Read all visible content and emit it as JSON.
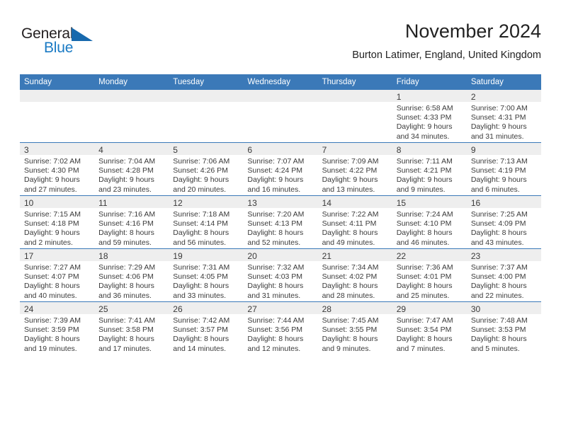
{
  "brand": {
    "name_part1": "General",
    "name_part2": "Blue",
    "triangle_color": "#1769ad",
    "blue_color": "#1a7ac4"
  },
  "header": {
    "title": "November 2024",
    "subtitle": "Burton Latimer, England, United Kingdom"
  },
  "theme": {
    "header_blue": "#3b79b8",
    "daynum_band": "#eeeeee",
    "text": "#3a3a3a"
  },
  "weekday_headers": [
    "Sunday",
    "Monday",
    "Tuesday",
    "Wednesday",
    "Thursday",
    "Friday",
    "Saturday"
  ],
  "weeks": [
    [
      {
        "day": "",
        "sunrise": "",
        "sunset": "",
        "daylight1": "",
        "daylight2": ""
      },
      {
        "day": "",
        "sunrise": "",
        "sunset": "",
        "daylight1": "",
        "daylight2": ""
      },
      {
        "day": "",
        "sunrise": "",
        "sunset": "",
        "daylight1": "",
        "daylight2": ""
      },
      {
        "day": "",
        "sunrise": "",
        "sunset": "",
        "daylight1": "",
        "daylight2": ""
      },
      {
        "day": "",
        "sunrise": "",
        "sunset": "",
        "daylight1": "",
        "daylight2": ""
      },
      {
        "day": "1",
        "sunrise": "Sunrise: 6:58 AM",
        "sunset": "Sunset: 4:33 PM",
        "daylight1": "Daylight: 9 hours",
        "daylight2": "and 34 minutes."
      },
      {
        "day": "2",
        "sunrise": "Sunrise: 7:00 AM",
        "sunset": "Sunset: 4:31 PM",
        "daylight1": "Daylight: 9 hours",
        "daylight2": "and 31 minutes."
      }
    ],
    [
      {
        "day": "3",
        "sunrise": "Sunrise: 7:02 AM",
        "sunset": "Sunset: 4:30 PM",
        "daylight1": "Daylight: 9 hours",
        "daylight2": "and 27 minutes."
      },
      {
        "day": "4",
        "sunrise": "Sunrise: 7:04 AM",
        "sunset": "Sunset: 4:28 PM",
        "daylight1": "Daylight: 9 hours",
        "daylight2": "and 23 minutes."
      },
      {
        "day": "5",
        "sunrise": "Sunrise: 7:06 AM",
        "sunset": "Sunset: 4:26 PM",
        "daylight1": "Daylight: 9 hours",
        "daylight2": "and 20 minutes."
      },
      {
        "day": "6",
        "sunrise": "Sunrise: 7:07 AM",
        "sunset": "Sunset: 4:24 PM",
        "daylight1": "Daylight: 9 hours",
        "daylight2": "and 16 minutes."
      },
      {
        "day": "7",
        "sunrise": "Sunrise: 7:09 AM",
        "sunset": "Sunset: 4:22 PM",
        "daylight1": "Daylight: 9 hours",
        "daylight2": "and 13 minutes."
      },
      {
        "day": "8",
        "sunrise": "Sunrise: 7:11 AM",
        "sunset": "Sunset: 4:21 PM",
        "daylight1": "Daylight: 9 hours",
        "daylight2": "and 9 minutes."
      },
      {
        "day": "9",
        "sunrise": "Sunrise: 7:13 AM",
        "sunset": "Sunset: 4:19 PM",
        "daylight1": "Daylight: 9 hours",
        "daylight2": "and 6 minutes."
      }
    ],
    [
      {
        "day": "10",
        "sunrise": "Sunrise: 7:15 AM",
        "sunset": "Sunset: 4:18 PM",
        "daylight1": "Daylight: 9 hours",
        "daylight2": "and 2 minutes."
      },
      {
        "day": "11",
        "sunrise": "Sunrise: 7:16 AM",
        "sunset": "Sunset: 4:16 PM",
        "daylight1": "Daylight: 8 hours",
        "daylight2": "and 59 minutes."
      },
      {
        "day": "12",
        "sunrise": "Sunrise: 7:18 AM",
        "sunset": "Sunset: 4:14 PM",
        "daylight1": "Daylight: 8 hours",
        "daylight2": "and 56 minutes."
      },
      {
        "day": "13",
        "sunrise": "Sunrise: 7:20 AM",
        "sunset": "Sunset: 4:13 PM",
        "daylight1": "Daylight: 8 hours",
        "daylight2": "and 52 minutes."
      },
      {
        "day": "14",
        "sunrise": "Sunrise: 7:22 AM",
        "sunset": "Sunset: 4:11 PM",
        "daylight1": "Daylight: 8 hours",
        "daylight2": "and 49 minutes."
      },
      {
        "day": "15",
        "sunrise": "Sunrise: 7:24 AM",
        "sunset": "Sunset: 4:10 PM",
        "daylight1": "Daylight: 8 hours",
        "daylight2": "and 46 minutes."
      },
      {
        "day": "16",
        "sunrise": "Sunrise: 7:25 AM",
        "sunset": "Sunset: 4:09 PM",
        "daylight1": "Daylight: 8 hours",
        "daylight2": "and 43 minutes."
      }
    ],
    [
      {
        "day": "17",
        "sunrise": "Sunrise: 7:27 AM",
        "sunset": "Sunset: 4:07 PM",
        "daylight1": "Daylight: 8 hours",
        "daylight2": "and 40 minutes."
      },
      {
        "day": "18",
        "sunrise": "Sunrise: 7:29 AM",
        "sunset": "Sunset: 4:06 PM",
        "daylight1": "Daylight: 8 hours",
        "daylight2": "and 36 minutes."
      },
      {
        "day": "19",
        "sunrise": "Sunrise: 7:31 AM",
        "sunset": "Sunset: 4:05 PM",
        "daylight1": "Daylight: 8 hours",
        "daylight2": "and 33 minutes."
      },
      {
        "day": "20",
        "sunrise": "Sunrise: 7:32 AM",
        "sunset": "Sunset: 4:03 PM",
        "daylight1": "Daylight: 8 hours",
        "daylight2": "and 31 minutes."
      },
      {
        "day": "21",
        "sunrise": "Sunrise: 7:34 AM",
        "sunset": "Sunset: 4:02 PM",
        "daylight1": "Daylight: 8 hours",
        "daylight2": "and 28 minutes."
      },
      {
        "day": "22",
        "sunrise": "Sunrise: 7:36 AM",
        "sunset": "Sunset: 4:01 PM",
        "daylight1": "Daylight: 8 hours",
        "daylight2": "and 25 minutes."
      },
      {
        "day": "23",
        "sunrise": "Sunrise: 7:37 AM",
        "sunset": "Sunset: 4:00 PM",
        "daylight1": "Daylight: 8 hours",
        "daylight2": "and 22 minutes."
      }
    ],
    [
      {
        "day": "24",
        "sunrise": "Sunrise: 7:39 AM",
        "sunset": "Sunset: 3:59 PM",
        "daylight1": "Daylight: 8 hours",
        "daylight2": "and 19 minutes."
      },
      {
        "day": "25",
        "sunrise": "Sunrise: 7:41 AM",
        "sunset": "Sunset: 3:58 PM",
        "daylight1": "Daylight: 8 hours",
        "daylight2": "and 17 minutes."
      },
      {
        "day": "26",
        "sunrise": "Sunrise: 7:42 AM",
        "sunset": "Sunset: 3:57 PM",
        "daylight1": "Daylight: 8 hours",
        "daylight2": "and 14 minutes."
      },
      {
        "day": "27",
        "sunrise": "Sunrise: 7:44 AM",
        "sunset": "Sunset: 3:56 PM",
        "daylight1": "Daylight: 8 hours",
        "daylight2": "and 12 minutes."
      },
      {
        "day": "28",
        "sunrise": "Sunrise: 7:45 AM",
        "sunset": "Sunset: 3:55 PM",
        "daylight1": "Daylight: 8 hours",
        "daylight2": "and 9 minutes."
      },
      {
        "day": "29",
        "sunrise": "Sunrise: 7:47 AM",
        "sunset": "Sunset: 3:54 PM",
        "daylight1": "Daylight: 8 hours",
        "daylight2": "and 7 minutes."
      },
      {
        "day": "30",
        "sunrise": "Sunrise: 7:48 AM",
        "sunset": "Sunset: 3:53 PM",
        "daylight1": "Daylight: 8 hours",
        "daylight2": "and 5 minutes."
      }
    ]
  ]
}
